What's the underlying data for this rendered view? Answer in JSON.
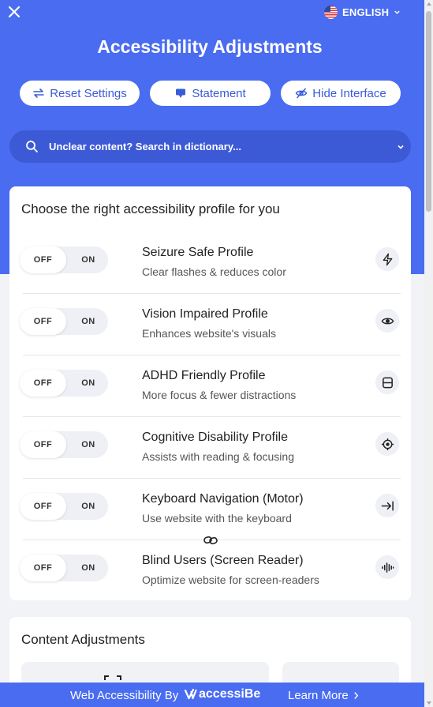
{
  "header": {
    "language": "ENGLISH",
    "title": "Accessibility Adjustments",
    "buttons": {
      "reset": "Reset Settings",
      "statement": "Statement",
      "hide": "Hide Interface"
    },
    "search_placeholder": "Unclear content? Search in dictionary..."
  },
  "profiles": {
    "heading": "Choose the right accessibility profile for you",
    "toggle_off": "OFF",
    "toggle_on": "ON",
    "items": [
      {
        "name": "Seizure Safe Profile",
        "desc": "Clear flashes & reduces color",
        "icon": "lightning-icon",
        "state": "OFF"
      },
      {
        "name": "Vision Impaired Profile",
        "desc": "Enhances website's visuals",
        "icon": "eye-icon",
        "state": "OFF"
      },
      {
        "name": "ADHD Friendly Profile",
        "desc": "More focus & fewer distractions",
        "icon": "focus-frame-icon",
        "state": "OFF"
      },
      {
        "name": "Cognitive Disability Profile",
        "desc": "Assists with reading & focusing",
        "icon": "target-icon",
        "state": "OFF"
      },
      {
        "name": "Keyboard Navigation (Motor)",
        "desc": "Use website with the keyboard",
        "icon": "tab-arrow-icon",
        "state": "OFF"
      },
      {
        "name": "Blind Users (Screen Reader)",
        "desc": "Optimize website for screen-readers",
        "icon": "audio-wave-icon",
        "state": "OFF"
      }
    ]
  },
  "content": {
    "heading": "Content Adjustments"
  },
  "footer": {
    "text": "Web Accessibility By",
    "brand": "accessiBe",
    "learn_more": "Learn More"
  },
  "colors": {
    "accent": "#4a6cf0",
    "search_bg": "#3d5ad6",
    "page_bg": "#f2f3f7"
  }
}
